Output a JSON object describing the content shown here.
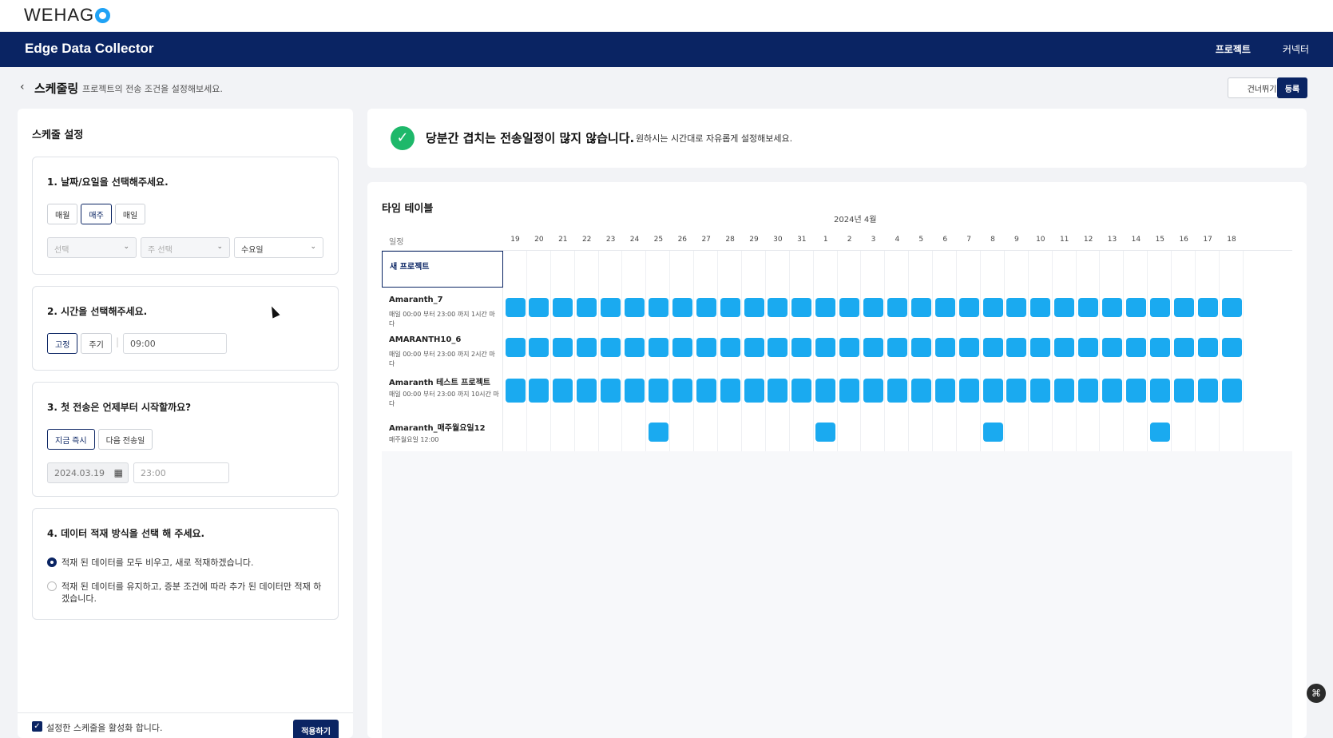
{
  "brand": {
    "logo_text": "WEHAG"
  },
  "app": {
    "title": "Edge Data Collector",
    "nav": [
      {
        "label": "프로젝트",
        "active": true
      },
      {
        "label": "커넥터",
        "active": false
      }
    ]
  },
  "page": {
    "title": "스케줄링",
    "subtitle": "프로젝트의 전송 조건을 설정해보세요.",
    "skip_label": "건너뛰기",
    "register_label": "등록"
  },
  "settings": {
    "title": "스케줄 설정",
    "step1": {
      "title": "1. 날짜/요일을 선택해주세요.",
      "options": [
        "매월",
        "매주",
        "매일"
      ],
      "selected": "매주",
      "select1": "선택",
      "select2": "주 선택",
      "select3": "수요일"
    },
    "step2": {
      "title": "2. 시간을 선택해주세요.",
      "options": [
        "고정",
        "주기"
      ],
      "selected": "고정",
      "time": "09:00"
    },
    "step3": {
      "title": "3. 첫 전송은 언제부터 시작할까요?",
      "options": [
        "지금 즉시",
        "다음 전송일"
      ],
      "selected": "지금 즉시",
      "date": "2024.03.19",
      "time": "23:00"
    },
    "step4": {
      "title": "4. 데이터 적재 방식을 선택 해 주세요.",
      "options": [
        "적재 된 데이터를 모두 비우고, 새로 적재하겠습니다.",
        "적재 된 데이터를 유지하고, 증분 조건에 따라 추가 된 데이터만 적재 하겠습니다."
      ],
      "selected_index": 0
    },
    "footer": {
      "activate_label": "설정한 스케줄을 활성화 합니다.",
      "activated": true,
      "apply_label": "적용하기"
    }
  },
  "banner": {
    "main": "당분간 겹치는 전송일정이 많지 않습니다.",
    "sub": "원하시는 시간대로 자유롭게 설정해보세요.",
    "status_color": "#1eb86a"
  },
  "timetable": {
    "title": "타임 테이블",
    "month": "2024년 4월",
    "schedule_label": "일정",
    "days": [
      "19",
      "20",
      "21",
      "22",
      "23",
      "24",
      "25",
      "26",
      "27",
      "28",
      "29",
      "30",
      "31",
      "1",
      "2",
      "3",
      "4",
      "5",
      "6",
      "7",
      "8",
      "9",
      "10",
      "11",
      "12",
      "13",
      "14",
      "15",
      "16",
      "17",
      "18"
    ],
    "block_color": "#1aaaf0",
    "rows": [
      {
        "name": "새 프로젝트",
        "desc": "",
        "new": true,
        "active_days": []
      },
      {
        "name": "Amaranth_7",
        "desc": "매일 00:00 부터 23:00 까지 1시간 마다",
        "new": false,
        "active_days": [
          0,
          1,
          2,
          3,
          4,
          5,
          6,
          7,
          8,
          9,
          10,
          11,
          12,
          13,
          14,
          15,
          16,
          17,
          18,
          19,
          20,
          21,
          22,
          23,
          24,
          25,
          26,
          27,
          28,
          29,
          30
        ]
      },
      {
        "name": "AMARANTH10_6",
        "desc": "매일 00:00 부터 23:00 까지 2시간 마다",
        "new": false,
        "active_days": [
          0,
          1,
          2,
          3,
          4,
          5,
          6,
          7,
          8,
          9,
          10,
          11,
          12,
          13,
          14,
          15,
          16,
          17,
          18,
          19,
          20,
          21,
          22,
          23,
          24,
          25,
          26,
          27,
          28,
          29,
          30
        ]
      },
      {
        "name": "Amaranth 테스트 프로젝트",
        "desc": "매일 00:00 부터 23:00 까지 10시간 마다",
        "new": false,
        "active_days": [
          0,
          1,
          2,
          3,
          4,
          5,
          6,
          7,
          8,
          9,
          10,
          11,
          12,
          13,
          14,
          15,
          16,
          17,
          18,
          19,
          20,
          21,
          22,
          23,
          24,
          25,
          26,
          27,
          28,
          29,
          30
        ]
      },
      {
        "name": "Amaranth_매주월요일12",
        "desc": "매주월요일 12:00",
        "new": false,
        "active_days": [
          6,
          13,
          20,
          27
        ]
      }
    ]
  },
  "fab_icon": "assistant-icon"
}
